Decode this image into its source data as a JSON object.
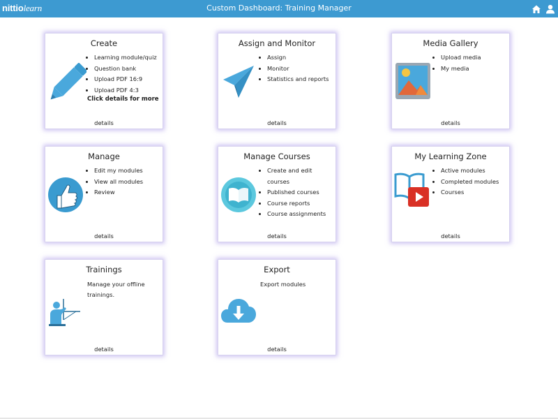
{
  "header": {
    "logo_main": "nittio",
    "logo_sub": "learn",
    "title": "Custom Dashboard: Training Manager",
    "icons": [
      "home-icon",
      "user-icon"
    ]
  },
  "cards": [
    {
      "title": "Create",
      "items": [
        "Learning module/quiz",
        "Question bank",
        "Upload PDF 16:9",
        "Upload PDF 4:3"
      ],
      "extra": "Click details for more",
      "details": "details",
      "icon": "pencil-icon"
    },
    {
      "title": "Assign and Monitor",
      "items": [
        "Assign",
        "Monitor",
        "Statistics and reports"
      ],
      "details": "details",
      "icon": "paper-plane-icon"
    },
    {
      "title": "Media Gallery",
      "items": [
        "Upload media",
        "My media"
      ],
      "details": "details",
      "icon": "image-icon"
    },
    {
      "title": "Manage",
      "items": [
        "Edit my modules",
        "View all modules",
        "Review"
      ],
      "details": "details",
      "icon": "thumbs-up-icon"
    },
    {
      "title": "Manage Courses",
      "items": [
        "Create and edit courses",
        "Published courses",
        "Course reports",
        "Course assignments"
      ],
      "details": "details",
      "icon": "book-icon"
    },
    {
      "title": "My Learning Zone",
      "items": [
        "Active modules",
        "Completed modules",
        "Courses"
      ],
      "details": "details",
      "icon": "video-book-icon"
    },
    {
      "title": "Trainings",
      "description": "Manage your offline trainings.",
      "details": "details",
      "icon": "trainer-icon"
    },
    {
      "title": "Export",
      "description": "Export modules",
      "details": "details",
      "icon": "cloud-download-icon"
    }
  ],
  "colors": {
    "header_bg": "#3d9ad1",
    "icon_blue": "#4aa8dc",
    "card_glow": "#b4a5eb",
    "video_red": "#e02b2b"
  }
}
